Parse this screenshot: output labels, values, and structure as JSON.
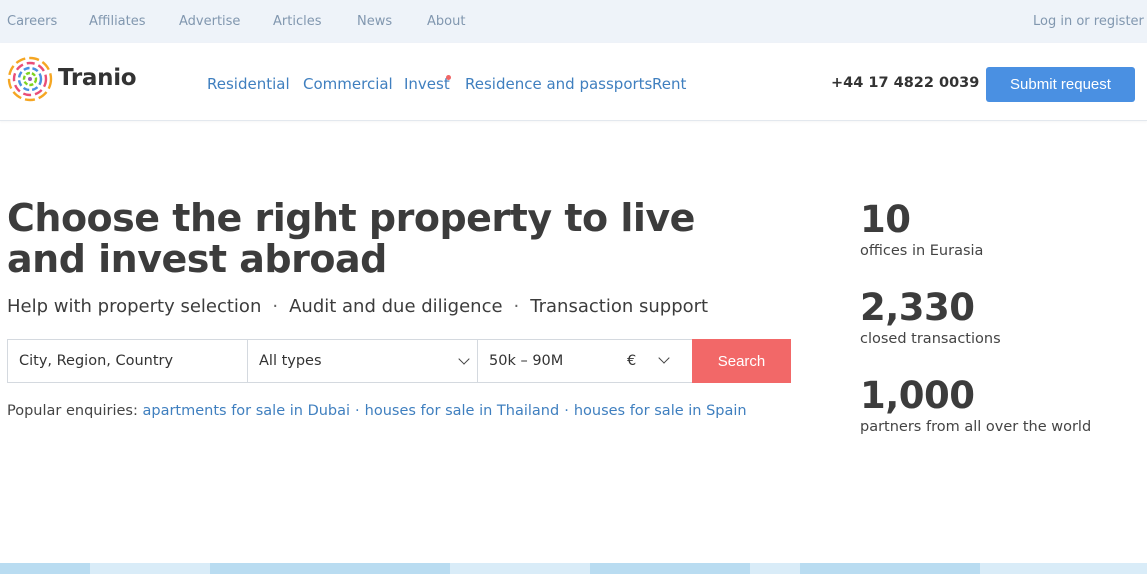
{
  "topbar": {
    "links": [
      "Careers",
      "Affiliates",
      "Advertise",
      "Articles",
      "News",
      "About"
    ],
    "login": "Log in or register"
  },
  "header": {
    "logo_text": "Tranio",
    "nav": [
      "Residential",
      "Commercial",
      "Invest",
      "Residence and passports",
      "Rent"
    ],
    "phone": "+44 17 4822 0039",
    "submit_label": "Submit request"
  },
  "hero": {
    "title": "Choose the right property to live and invest abroad",
    "services": [
      "Help with property selection",
      "Audit and due diligence",
      "Transaction support"
    ],
    "separator": "·"
  },
  "search": {
    "location_placeholder": "City, Region, Country",
    "type_value": "All types",
    "price_value": "50k – 90M",
    "currency_value": "€",
    "button_label": "Search"
  },
  "popular": {
    "label": "Popular enquiries:",
    "links": [
      "apartments for sale in Dubai",
      "houses for sale in Thailand",
      "houses for sale in Spain"
    ],
    "separator": "·"
  },
  "stats": [
    {
      "number": "10",
      "label": "offices in Eurasia"
    },
    {
      "number": "2,330",
      "label": "closed transactions"
    },
    {
      "number": "1,000",
      "label": "partners from all over the world"
    }
  ],
  "colors": {
    "accent_blue": "#4a90e2",
    "link_blue": "#3f7fbf",
    "search_red": "#f26868",
    "notification_dot": "#f06565"
  },
  "icons": {
    "logo": "tranio-logo-icon",
    "select_arrow": "chevron-down-icon"
  }
}
